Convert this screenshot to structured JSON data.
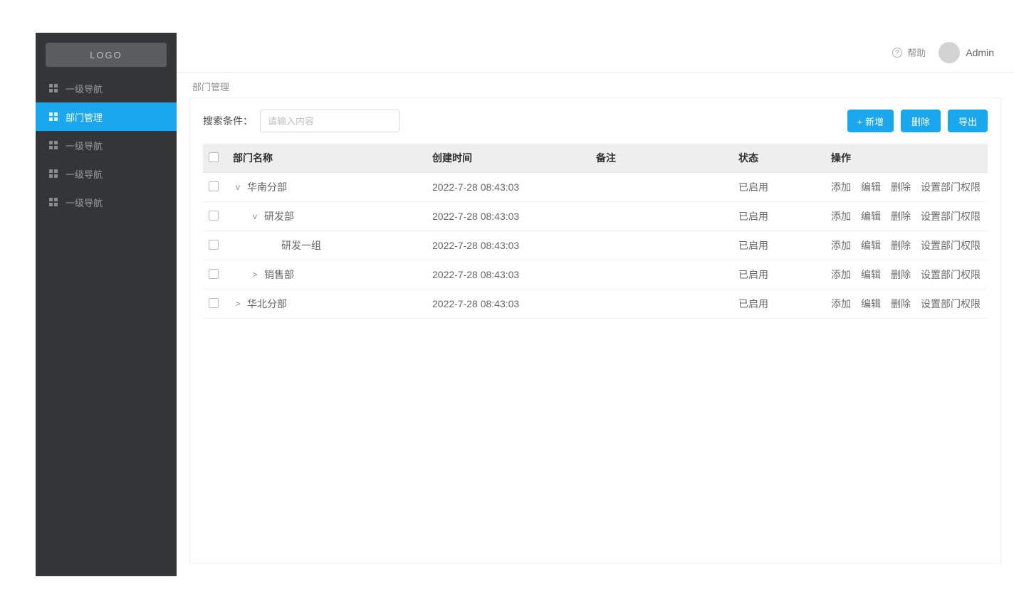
{
  "logo": "LOGO",
  "sidebar": {
    "items": [
      {
        "label": "一级导航",
        "active": false
      },
      {
        "label": "部门管理",
        "active": true
      },
      {
        "label": "一级导航",
        "active": false
      },
      {
        "label": "一级导航",
        "active": false
      },
      {
        "label": "一级导航",
        "active": false
      }
    ]
  },
  "header": {
    "help": "帮助",
    "username": "Admin"
  },
  "breadcrumb": "部门管理",
  "search": {
    "label": "搜索条件：",
    "placeholder": "请输入内容"
  },
  "buttons": {
    "add": "+ 新增",
    "delete": "删除",
    "export": "导出"
  },
  "columns": {
    "name": "部门名称",
    "created": "创建时间",
    "remark": "备注",
    "status": "状态",
    "ops": "操作"
  },
  "row_actions": {
    "add": "添加",
    "edit": "编辑",
    "delete": "删除",
    "perm": "设置部门权限"
  },
  "rows": [
    {
      "indent": 0,
      "toggle": "v",
      "name": "华南分部",
      "created": "2022-7-28 08:43:03",
      "remark": "",
      "status": "已启用"
    },
    {
      "indent": 1,
      "toggle": "v",
      "name": "研发部",
      "created": "2022-7-28 08:43:03",
      "remark": "",
      "status": "已启用"
    },
    {
      "indent": 2,
      "toggle": "",
      "name": "研发一组",
      "created": "2022-7-28 08:43:03",
      "remark": "",
      "status": "已启用"
    },
    {
      "indent": 1,
      "toggle": ">",
      "name": "销售部",
      "created": "2022-7-28 08:43:03",
      "remark": "",
      "status": "已启用"
    },
    {
      "indent": 0,
      "toggle": ">",
      "name": "华北分部",
      "created": "2022-7-28 08:43:03",
      "remark": "",
      "status": "已启用"
    }
  ]
}
